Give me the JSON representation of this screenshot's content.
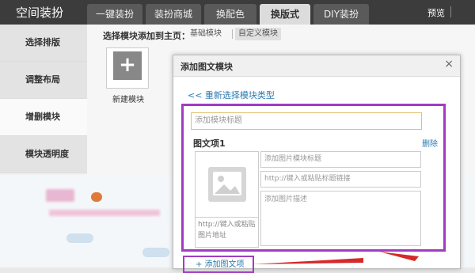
{
  "topbar": {
    "title": "空间装扮",
    "tabs": [
      {
        "label": "一键装扮"
      },
      {
        "label": "装扮商城"
      },
      {
        "label": "换配色"
      },
      {
        "label": "换版式"
      },
      {
        "label": "DIY装扮"
      }
    ],
    "preview": "预览"
  },
  "sidebar": {
    "items": [
      {
        "label": "选择排版"
      },
      {
        "label": "调整布局"
      },
      {
        "label": "增删模块"
      },
      {
        "label": "模块透明度"
      }
    ]
  },
  "main": {
    "header_label": "选择模块添加到主页：",
    "tabs": [
      {
        "label": "基础模块"
      },
      {
        "label": "自定义模块"
      }
    ],
    "new_module_label": "新建模块"
  },
  "dialog": {
    "title": "添加图文模块",
    "back_link": "<< 重新选择模块类型",
    "module_title_placeholder": "添加模块标题",
    "item_title": "图文项1",
    "delete_label": "删除",
    "image_url_placeholder": "http://键入或粘贴图片地址",
    "image_title_placeholder": "添加图片模块标题",
    "link_placeholder": "http://键入或粘贴标题链接",
    "desc_placeholder": "添加图片描述",
    "add_item_label": "+ 添加图文项"
  },
  "colors": {
    "highlight": "#a23bc4",
    "arrow": "#d42a2a",
    "link": "#2a7ab0"
  }
}
